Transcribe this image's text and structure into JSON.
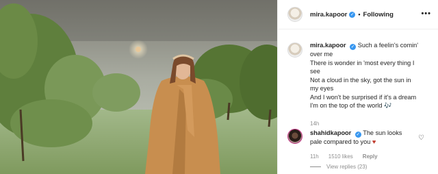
{
  "post": {
    "author": "mira.kapoor",
    "header_separator": "•",
    "follow_label": "Following",
    "more_label": "•••",
    "caption_lines": [
      "Such a feelin's comin'",
      "over me",
      "There is wonder in 'most every thing I",
      "see",
      "Not a cloud in the sky, got the sun in",
      "my eyes",
      "And I won't be surprised if it's a dream",
      "I'm on the top of the world 🎶"
    ],
    "timestamp": "14h"
  },
  "comment": {
    "author": "shahidkapoor",
    "text_line1": "The sun looks",
    "text_line2": "pale compared to you",
    "heart": "♥",
    "time": "11h",
    "likes": "1510 likes",
    "reply_label": "Reply",
    "view_replies": "View replies (23)"
  },
  "icons": {
    "verified": "✓",
    "like": "♡"
  },
  "colors": {
    "verified_blue": "#3897f0",
    "meta_gray": "#8e8e8e",
    "heart_red": "#c0392b",
    "text": "#262626"
  }
}
